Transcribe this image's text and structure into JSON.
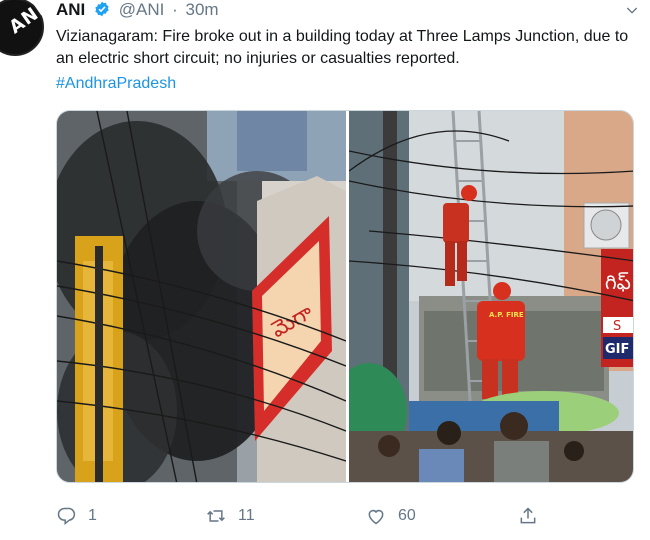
{
  "account": {
    "display_name": "ANI",
    "handle": "@ANI",
    "separator": "·",
    "time": "30m",
    "avatar_text": "ANI"
  },
  "tweet": {
    "text": "Vizianagaram: Fire broke out in a building today at Three Lamps Junction, due to an electric short circuit; no injuries or casualties reported.",
    "hashtag": "#AndhraPradesh"
  },
  "media": {
    "left_sign_text": "మెగా",
    "right_sign_text": "గిఫ్",
    "right_sign_sub": "S",
    "right_sign_sub2": "GIF",
    "firefighter_label": "A.P. FIRE"
  },
  "actions": {
    "reply_count": "1",
    "retweet_count": "11",
    "like_count": "60"
  },
  "colors": {
    "verified_blue": "#1da1f2",
    "hashtag_blue": "#1b95e0",
    "muted": "#657786",
    "smoke": "#2a2c2e",
    "firefighter_red": "#d8301e"
  },
  "icons": [
    "verified-badge-icon",
    "caret-down-icon",
    "reply-icon",
    "retweet-icon",
    "like-icon",
    "share-icon"
  ]
}
